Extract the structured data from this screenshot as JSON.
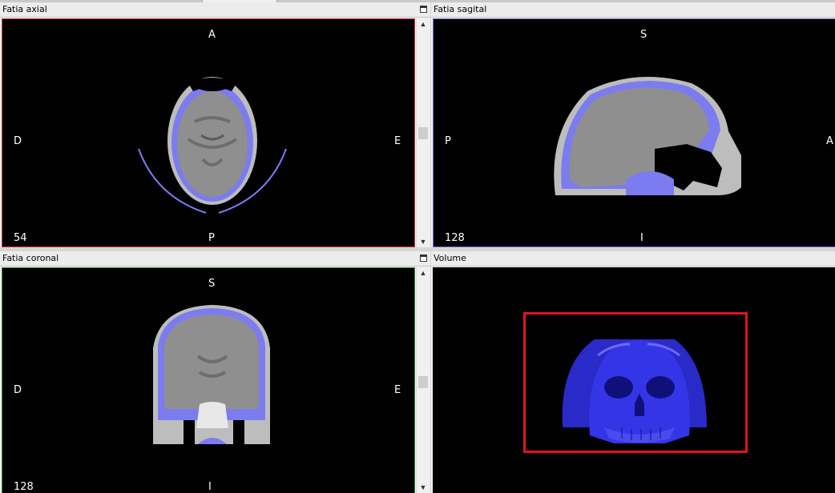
{
  "panels": {
    "axial": {
      "title": "Fatia axial",
      "orient": {
        "top": "A",
        "bottom": "P",
        "left": "D",
        "right": "E"
      },
      "slice": "54",
      "border": "#c83c3c"
    },
    "sagittal": {
      "title": "Fatia sagital",
      "orient": {
        "top": "S",
        "bottom": "I",
        "left": "P",
        "right": "A"
      },
      "slice": "128",
      "border": "#6b72c8"
    },
    "coronal": {
      "title": "Fatia coronal",
      "orient": {
        "top": "S",
        "bottom": "I",
        "left": "D",
        "right": "E"
      },
      "slice": "128",
      "border": "#3a8a3a"
    },
    "volume": {
      "title": "Volume",
      "highlight": "#e0141e",
      "render_color": "#2f2fe0"
    }
  },
  "icons": {
    "maximize": "maximize-icon",
    "scroll_up": "scroll-up-arrow",
    "scroll_down": "scroll-down-arrow"
  },
  "colors": {
    "overlay": "#7c7cf0",
    "tissue": "#8a8a8a"
  }
}
